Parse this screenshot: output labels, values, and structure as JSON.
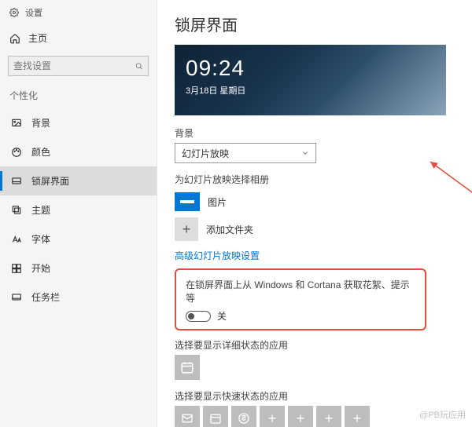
{
  "header": {
    "app_name": "设置"
  },
  "sidebar": {
    "home_label": "主页",
    "search_placeholder": "查找设置",
    "section_label": "个性化",
    "items": [
      {
        "label": "背景"
      },
      {
        "label": "颜色"
      },
      {
        "label": "锁屏界面"
      },
      {
        "label": "主题"
      },
      {
        "label": "字体"
      },
      {
        "label": "开始"
      },
      {
        "label": "任务栏"
      }
    ]
  },
  "main": {
    "title": "锁屏界面",
    "preview": {
      "time": "09:24",
      "date": "3月18日 星期日"
    },
    "background_label": "背景",
    "background_dropdown": {
      "selected": "幻灯片放映"
    },
    "albums_label": "为幻灯片放映选择相册",
    "album_items": [
      {
        "label": "图片"
      }
    ],
    "add_folder_label": "添加文件夹",
    "advanced_link": "高级幻灯片放映设置",
    "cortana_label": "在锁屏界面上从 Windows 和 Cortana 获取花絮、提示等",
    "cortana_toggle_value": "关",
    "detailed_status_label": "选择要显示详细状态的应用",
    "quick_status_label": "选择要显示快速状态的应用"
  },
  "watermark": "@PB玩应用"
}
